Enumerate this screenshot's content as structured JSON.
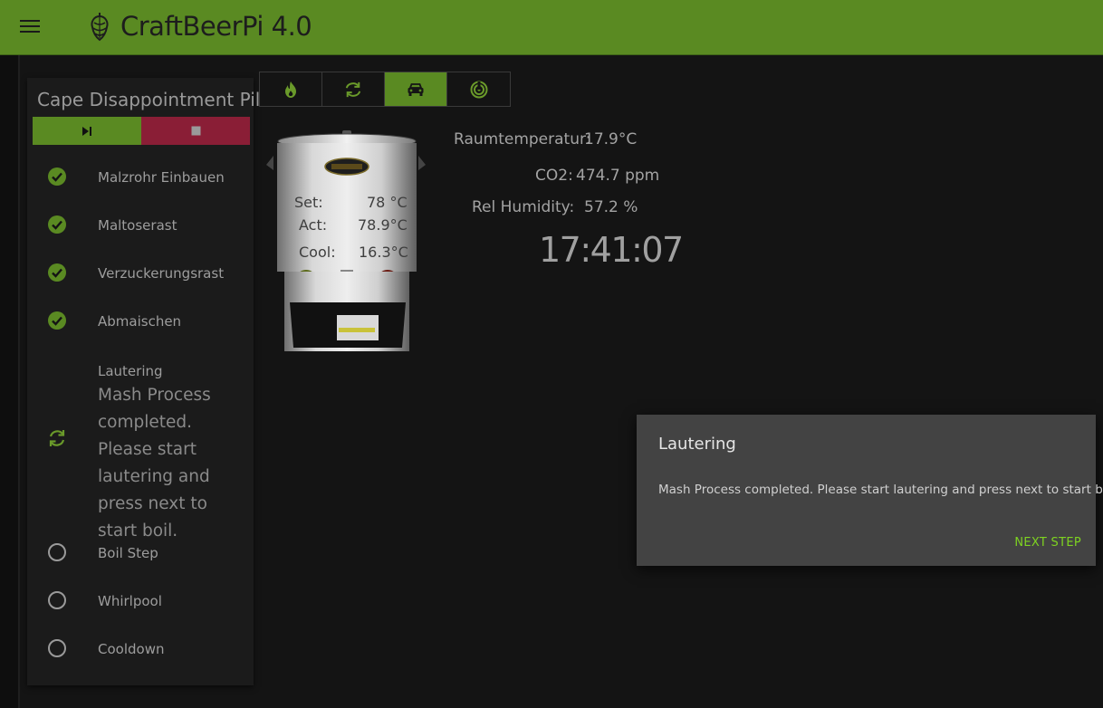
{
  "app": {
    "title": "CraftBeerPi 4.0"
  },
  "recipe": {
    "name": "Cape Disappointment Pils",
    "steps": [
      {
        "label": "Malzrohr Einbauen",
        "status": "done",
        "icon": "check-circle-icon"
      },
      {
        "label": "Maltoserast",
        "status": "done",
        "icon": "check-circle-icon"
      },
      {
        "label": "Verzuckerungsrast",
        "status": "done",
        "icon": "check-circle-icon"
      },
      {
        "label": "Abmaischen",
        "status": "done",
        "icon": "check-circle-icon"
      },
      {
        "label": "Lautering",
        "status": "active",
        "icon": "sync-icon",
        "message": "Mash Process completed. Please start lautering and press next to start boil."
      },
      {
        "label": "Boil Step",
        "status": "pending",
        "icon": "empty-circle-icon"
      },
      {
        "label": "Whirlpool",
        "status": "pending",
        "icon": "empty-circle-icon"
      },
      {
        "label": "Cooldown",
        "status": "pending",
        "icon": "empty-circle-icon"
      }
    ]
  },
  "toolbar": {
    "buttons": [
      {
        "icon": "flame-icon",
        "active": false
      },
      {
        "icon": "sync-icon",
        "active": false
      },
      {
        "icon": "car-icon",
        "active": true
      },
      {
        "icon": "radar-icon",
        "active": false
      }
    ]
  },
  "kettle": {
    "set_label": "Set:",
    "set_value": "78 °C",
    "act_label": "Act:",
    "act_value": "78.9°C",
    "cool_label": "Cool:",
    "cool_value": "16.3°C"
  },
  "sensors": {
    "room_label": "Raumtemperatur:",
    "room_value": "17.9°C",
    "co2_label": "CO2:",
    "co2_value": "474.7 ppm",
    "hum_label": "Rel Humidity:",
    "hum_value": "57.2 %"
  },
  "clock": "17:41:07",
  "dialog": {
    "title": "Lautering",
    "message": "Mash Process completed. Please start lautering and press next to start boil.",
    "button": "NEXT STEP"
  },
  "colors": {
    "accent": "#5a8a22",
    "stop": "#8a1e36",
    "dialog_button": "#7ed321"
  }
}
